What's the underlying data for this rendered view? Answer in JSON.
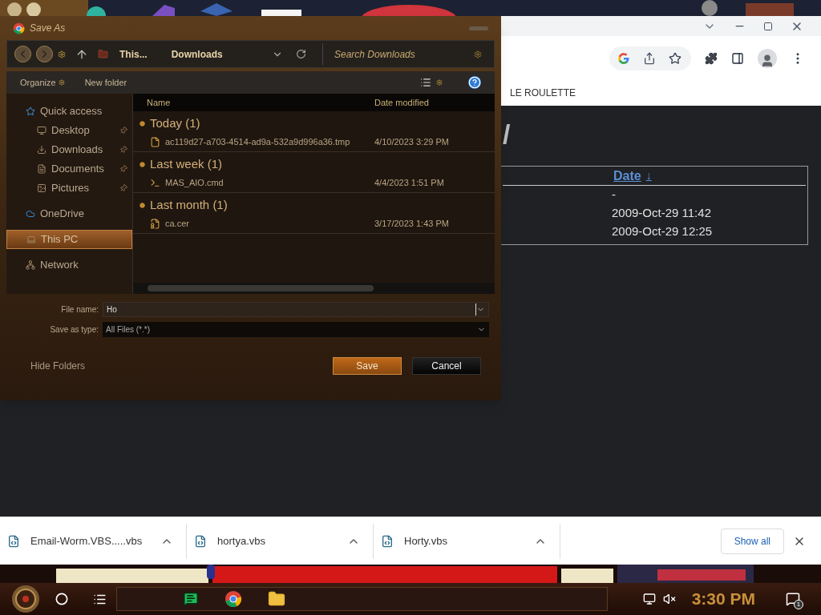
{
  "browser": {
    "bookmark": "LE ROULETTE",
    "heading": "/",
    "table": {
      "column_header": "Date",
      "sort_mark": "↓",
      "rows": [
        "-",
        "2009-Oct-29 11:42",
        "2009-Oct-29 12:25"
      ]
    }
  },
  "dialog": {
    "title": "Save As",
    "breadcrumb": [
      "This...",
      "Downloads"
    ],
    "search": {
      "placeholder": "Search Downloads"
    },
    "toolbar": [
      "Organize",
      "New folder"
    ],
    "nav": [
      {
        "label": "Quick access",
        "kind": "star",
        "pinned": false,
        "selected": false
      },
      {
        "label": "Desktop",
        "kind": "desktop",
        "pinned": true,
        "selected": false
      },
      {
        "label": "Downloads",
        "kind": "download",
        "pinned": true,
        "selected": false
      },
      {
        "label": "Documents",
        "kind": "document",
        "pinned": true,
        "selected": false
      },
      {
        "label": "Pictures",
        "kind": "picture",
        "pinned": true,
        "selected": false
      },
      {
        "label": "OneDrive",
        "kind": "cloud",
        "pinned": false,
        "selected": false
      },
      {
        "label": "This PC",
        "kind": "pc",
        "pinned": false,
        "selected": true
      },
      {
        "label": "Network",
        "kind": "network",
        "pinned": false,
        "selected": false
      }
    ],
    "columns": [
      "Name",
      "Date modified"
    ],
    "groups": [
      {
        "label": "Today (1)",
        "files": [
          {
            "name": "ac119d27-a703-4514-ad9a-532a9d996a36.tmp",
            "date": "4/10/2023 3:29 PM",
            "kind": "tmp"
          }
        ]
      },
      {
        "label": "Last week (1)",
        "files": [
          {
            "name": "MAS_AIO.cmd",
            "date": "4/4/2023 1:51 PM",
            "kind": "cmd"
          }
        ]
      },
      {
        "label": "Last month (1)",
        "files": [
          {
            "name": "ca.cer",
            "date": "3/17/2023 1:43 PM",
            "kind": "cert"
          }
        ]
      }
    ],
    "file_name": {
      "label": "File name:",
      "value": "Ho"
    },
    "save_type": {
      "label": "Save as type:",
      "value": "All Files (*.*)"
    },
    "hide_folders": "Hide Folders",
    "buttons": [
      {
        "label": "Save",
        "kind": "primary"
      },
      {
        "label": "Cancel",
        "kind": "secondary"
      }
    ]
  },
  "downloads": {
    "items": [
      "Email-Worm.VBS.....vbs",
      "hortya.vbs",
      "Horty.vbs"
    ],
    "show_all": "Show all"
  },
  "taskbar": {
    "clock": "3:30 PM",
    "notification_count": "1"
  }
}
